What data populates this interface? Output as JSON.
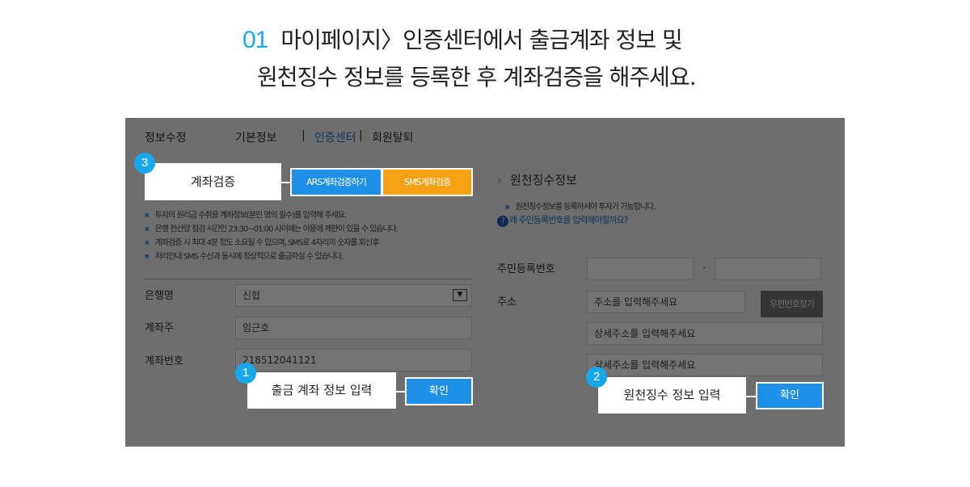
{
  "heading": {
    "step": "01",
    "line1": "마이페이지〉인증센터에서 출금계좌 정보 및",
    "line2": "원천징수 정보를 등록한 후 계좌검증을 해주세요."
  },
  "tabs": {
    "title": "정보수정",
    "items": [
      "기본정보",
      "인증센터",
      "회원탈퇴"
    ],
    "active": "인증센터",
    "separator": "|"
  },
  "left": {
    "section_title": "계좌검증",
    "ars_button": "ARS계좌검증하기",
    "sms_button": "SMS계좌검증",
    "notes": [
      "투자의 원리금 수취용 계좌정보(본인 명의 필수)를 입력해 주세요.",
      "은행 전산망 점검 시간인 23:30~01:00 사이에는 이용에 제한이 있을 수 있습니다.",
      "계좌검증 시 최대 4분 정도 소요될 수 있으며, SMS로 4자리의 숫자를 회신후",
      "처리안내 SMS 수신과 동시에 정상적으로 출금하실 수 있습니다."
    ],
    "fields": {
      "bank_label": "은행명",
      "bank_value": "신협",
      "holder_label": "계좌주",
      "holder_value": "임근호",
      "account_label": "계좌번호",
      "account_value": "218512041121"
    }
  },
  "right": {
    "section_title": "원천징수정보",
    "note": "원천징수정보를 등록하셔야 투자가 가능합니다.",
    "help_link": "왜 주민등록번호를 입력해야할까요?",
    "rrn_label": "주민등록번호",
    "rrn_dash": "-",
    "address_label": "주소",
    "address_placeholder": "주소를 입력해주세요",
    "zip_button": "우편번호찾기",
    "detail1_placeholder": "상세주소를 입력해주세요",
    "detail2_placeholder": "상세주소를 입력해주세요"
  },
  "callouts": {
    "c1": {
      "badge": "1",
      "label": "출금 계좌 정보  입력",
      "button": "확인"
    },
    "c2": {
      "badge": "2",
      "label": "원천징수 정보 입력",
      "button": "확인"
    },
    "c3": {
      "badge": "3"
    }
  },
  "colors": {
    "accent": "#16a8ea",
    "primary_button": "#1e90e8",
    "sms_button": "#f5a114",
    "overlay": "rgba(0,0,0,0.55)"
  }
}
